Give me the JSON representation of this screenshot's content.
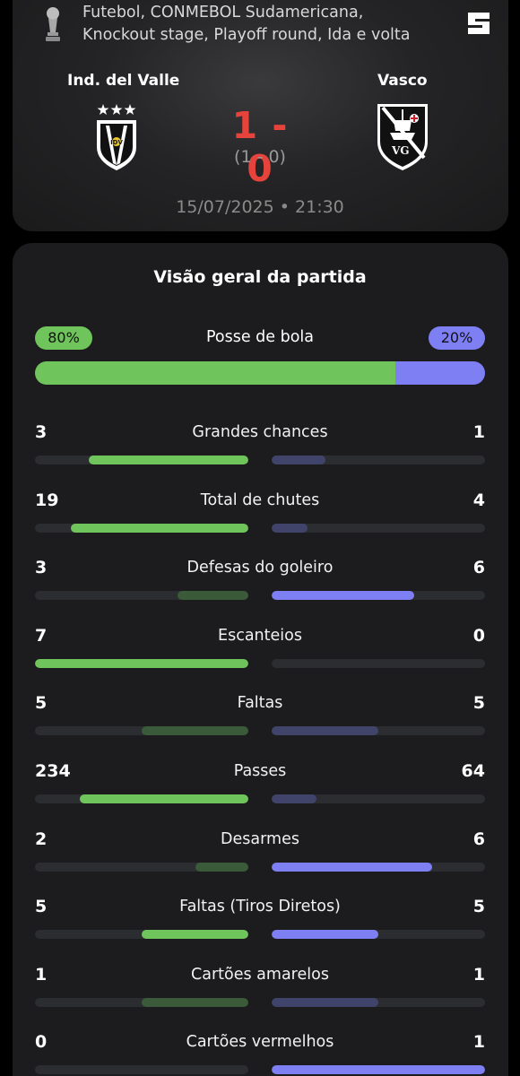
{
  "match": {
    "competition_line1": "Futebol, CONMEBOL Sudamericana,",
    "competition_line2": "Knockout stage, Playoff round, Ida e volta",
    "home_team": "Ind. del Valle",
    "away_team": "Vasco",
    "score": "1 - 0",
    "aggregate": "(1 - 0)",
    "datetime": "15/07/2025 • 21:30"
  },
  "overview": {
    "title": "Visão geral da partida",
    "possession": {
      "label": "Posse de bola",
      "home_text": "80%",
      "away_text": "20%",
      "home_fraction": 0.8,
      "away_fraction": 0.2
    }
  },
  "colors": {
    "home_strong": "#6fc45b",
    "home_dim": "#3b5a3a",
    "away_strong": "#7d7ff3",
    "away_dim": "#41446a",
    "track": "#2c2d30",
    "score": "#e5433b"
  },
  "stats": [
    {
      "label": "Grandes chances",
      "home": "3",
      "away": "1",
      "home_fill": 0.75,
      "away_fill": 0.25,
      "leader": "home"
    },
    {
      "label": "Total de chutes",
      "home": "19",
      "away": "4",
      "home_fill": 0.83,
      "away_fill": 0.17,
      "leader": "home"
    },
    {
      "label": "Defesas do goleiro",
      "home": "3",
      "away": "6",
      "home_fill": 0.33,
      "away_fill": 0.67,
      "leader": "away"
    },
    {
      "label": "Escanteios",
      "home": "7",
      "away": "0",
      "home_fill": 1.0,
      "away_fill": 0.0,
      "leader": "home"
    },
    {
      "label": "Faltas",
      "home": "5",
      "away": "5",
      "home_fill": 0.5,
      "away_fill": 0.5,
      "leader": "none"
    },
    {
      "label": "Passes",
      "home": "234",
      "away": "64",
      "home_fill": 0.79,
      "away_fill": 0.21,
      "leader": "home"
    },
    {
      "label": "Desarmes",
      "home": "2",
      "away": "6",
      "home_fill": 0.25,
      "away_fill": 0.75,
      "leader": "away"
    },
    {
      "label": "Faltas (Tiros Diretos)",
      "home": "5",
      "away": "5",
      "home_fill": 0.5,
      "away_fill": 0.5,
      "leader": "both"
    },
    {
      "label": "Cartões amarelos",
      "home": "1",
      "away": "1",
      "home_fill": 0.5,
      "away_fill": 0.5,
      "leader": "none"
    },
    {
      "label": "Cartões vermelhos",
      "home": "0",
      "away": "1",
      "home_fill": 0.0,
      "away_fill": 1.0,
      "leader": "away"
    }
  ]
}
